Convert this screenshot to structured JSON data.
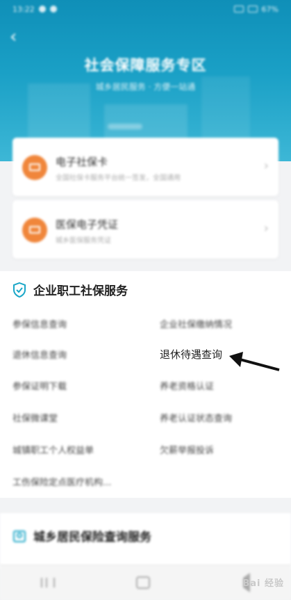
{
  "status_bar": {
    "time": "13:22",
    "battery": "67%"
  },
  "header": {
    "back_glyph": "‹",
    "title": "社会保障服务专区",
    "subtitle": "城乡居民服务 · 方便一站通"
  },
  "top_cards": [
    {
      "title": "电子社保卡",
      "subtitle": "全国社保卡服务平台统一签发，全国通用",
      "icon": "id-card-icon"
    },
    {
      "title": "医保电子凭证",
      "subtitle": "城乡医保服务凭证",
      "icon": "medical-card-icon"
    }
  ],
  "enterprise_section": {
    "title": "企业职工社保服务",
    "icon": "shield-check-icon",
    "items_left": [
      "参保信息查询",
      "退休信息查询",
      "参保证明下载",
      "社保微课堂",
      "城镇职工个人权益单",
      "工伤保险定点医疗机构..."
    ],
    "items_right": [
      "企业社保缴纳情况",
      "退休待遇查询",
      "养老资格认证",
      "养老认证状态查询",
      "欠薪举报投诉"
    ]
  },
  "resident_section": {
    "title": "城乡居民保险查询服务",
    "icon": "person-card-icon"
  },
  "watermark": "Bai 经验",
  "colors": {
    "accent": "#1aa0c6",
    "orange": "#f0863b",
    "shield": "#19a6c7"
  }
}
